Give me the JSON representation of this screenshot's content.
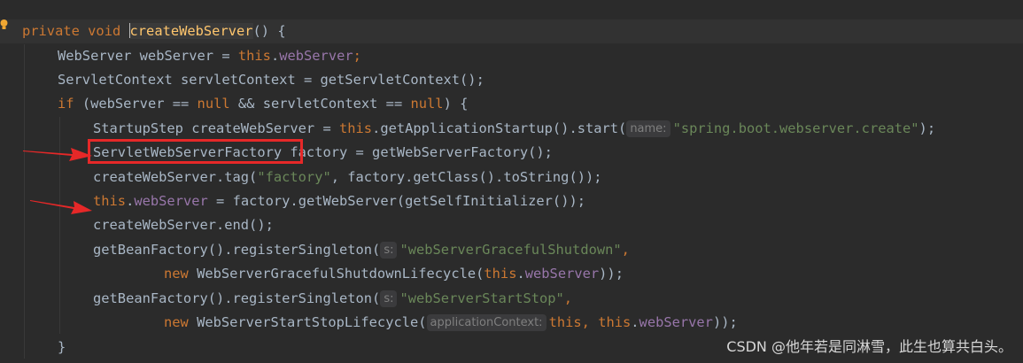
{
  "code": {
    "l1_private": "private",
    "l1_void": "void",
    "l1_method": "createWebServer",
    "l1_tail": "() {",
    "l2_a": "WebServer webServer = ",
    "l2_this": "this",
    "l2_dot": ".",
    "l2_field": "webServer",
    "l2_semi": ";",
    "l3": "ServletContext servletContext = getServletContext();",
    "l4_if": "if",
    "l4_a": " (webServer == ",
    "l4_null1": "null",
    "l4_b": " && servletContext == ",
    "l4_null2": "null",
    "l4_c": ") {",
    "l5_a": "StartupStep createWebServer = ",
    "l5_this": "this",
    "l5_b": ".getApplicationStartup().start(",
    "l5_hint": "name:",
    "l5_str": "\"spring.boot.webserver.create\"",
    "l5_c": ");",
    "l6_type": "ServletWebServerFactory",
    "l6_rest": " factory = getWebServerFactory();",
    "l7_a": "createWebServer.tag(",
    "l7_str": "\"factory\"",
    "l7_b": ", factory.getClass().toString());",
    "l8_this": "this",
    "l8_dot": ".",
    "l8_field": "webServer",
    "l8_rest": " = factory.getWebServer(getSelfInitializer());",
    "l9": "createWebServer.end();",
    "l10_a": "getBeanFactory().registerSingleton(",
    "l10_hint": "s:",
    "l10_str": "\"webServerGracefulShutdown\"",
    "l10_b": ",",
    "l11_new": "new",
    "l11_a": " WebServerGracefulShutdownLifecycle(",
    "l11_this": "this",
    "l11_dot": ".",
    "l11_field": "webServer",
    "l11_b": "));",
    "l12_a": "getBeanFactory().registerSingleton(",
    "l12_hint": "s:",
    "l12_str": "\"webServerStartStop\"",
    "l12_b": ",",
    "l13_new": "new",
    "l13_a": " WebServerStartStopLifecycle(",
    "l13_hint": "applicationContext:",
    "l13_this1": "this",
    "l13_b": ", ",
    "l13_this2": "this",
    "l13_dot": ".",
    "l13_field": "webServer",
    "l13_c": "));",
    "l14": "}"
  },
  "watermark": "CSDN @他年若是同淋雪，此生也算共白头。",
  "colors": {
    "background": "#2b2b2b",
    "keyword": "#cc7832",
    "field": "#9876aa",
    "string": "#6a8759",
    "text": "#a9b7c6",
    "annotation_red": "#e62828"
  },
  "icons": [
    "lightbulb-icon",
    "red-arrow-annotation",
    "red-box-annotation"
  ]
}
